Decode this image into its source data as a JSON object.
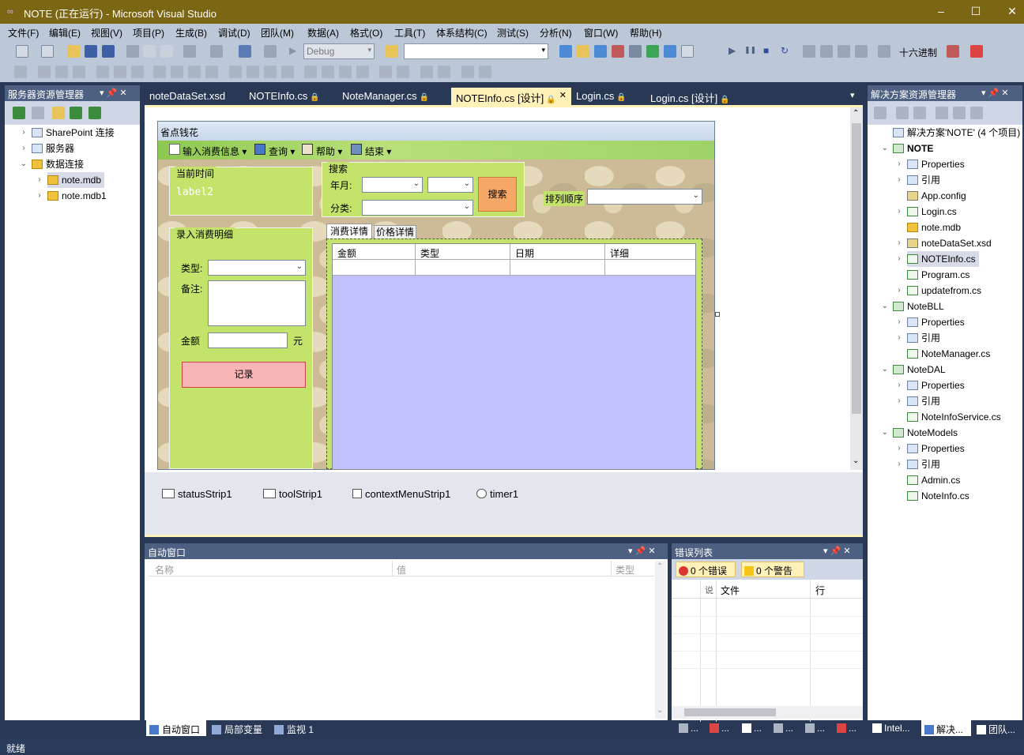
{
  "window": {
    "title": "NOTE (正在运行) - Microsoft Visual Studio",
    "logo": "∞",
    "minimize": "–",
    "maximize": "☐",
    "close": "✕"
  },
  "menu": [
    "文件(F)",
    "编辑(E)",
    "视图(V)",
    "项目(P)",
    "生成(B)",
    "调试(D)",
    "团队(M)",
    "数据(A)",
    "格式(O)",
    "工具(T)",
    "体系结构(C)",
    "测试(S)",
    "分析(N)",
    "窗口(W)",
    "帮助(H)"
  ],
  "toolbar": {
    "config": "Debug",
    "hex": "十六进制",
    "dropdown_arrow": "▾",
    "play": "▶",
    "pause": "❚❚",
    "stop": "■",
    "restart": "↻"
  },
  "server_explorer": {
    "title": "服务器资源管理器",
    "pin": "▾ 📌 ✕",
    "items": [
      {
        "label": "SharePoint 连接",
        "expander": "›"
      },
      {
        "label": "服务器",
        "expander": "›"
      },
      {
        "label": "数据连接",
        "expander": "⌄"
      },
      {
        "label": "note.mdb",
        "expander": "›"
      },
      {
        "label": "note.mdb1",
        "expander": "›"
      }
    ]
  },
  "doc_tabs": [
    {
      "label": "noteDataSet.xsd",
      "lock": ""
    },
    {
      "label": "NOTEInfo.cs",
      "lock": "🔒"
    },
    {
      "label": "NoteManager.cs",
      "lock": "🔒"
    },
    {
      "label": "NOTEInfo.cs [设计]",
      "lock": "🔒",
      "close": "✕"
    },
    {
      "label": "Login.cs",
      "lock": "🔒"
    },
    {
      "label": "Login.cs [设计]",
      "lock": "🔒"
    }
  ],
  "doc_tabs_overflow": "▾",
  "designer": {
    "form_title": "省点钱花",
    "menu_items": [
      "输入消费信息",
      "查询",
      "帮助",
      "结束"
    ],
    "menu_arrow": "▾",
    "group_time": {
      "title": "当前时间",
      "label": "label2"
    },
    "group_search": {
      "title": "搜索",
      "year_label": "年月:",
      "category_label": "分类:",
      "button": "搜索"
    },
    "sort_label": "排列顺序",
    "group_entry": {
      "title": "录入消费明细",
      "type_label": "类型:",
      "note_label": "备注:",
      "amount_label": "金额",
      "unit": "元",
      "button": "记录"
    },
    "tabs": [
      "消费详情",
      "价格详情"
    ],
    "grid_headers": [
      "金额",
      "类型",
      "日期",
      "详细"
    ],
    "scroll_up": "⌃",
    "scroll_down": "⌄",
    "components": [
      "statusStrip1",
      "toolStrip1",
      "contextMenuStrip1",
      "timer1"
    ]
  },
  "solution_explorer": {
    "title": "解决方案资源管理器",
    "pin": "▾ 📌 ✕",
    "items": [
      {
        "label": "解决方案'NOTE' (4 个项目)",
        "level": 0,
        "icon": "sol",
        "exp": ""
      },
      {
        "label": "NOTE",
        "level": 0,
        "icon": "proj",
        "exp": "⌄",
        "bold": true
      },
      {
        "label": "Properties",
        "level": 1,
        "icon": "fold",
        "exp": "›"
      },
      {
        "label": "引用",
        "level": 1,
        "icon": "fold",
        "exp": "›"
      },
      {
        "label": "App.config",
        "level": 1,
        "icon": "file",
        "exp": ""
      },
      {
        "label": "Login.cs",
        "level": 1,
        "icon": "cs",
        "exp": "›"
      },
      {
        "label": "note.mdb",
        "level": 1,
        "icon": "db",
        "exp": ""
      },
      {
        "label": "noteDataSet.xsd",
        "level": 1,
        "icon": "file",
        "exp": "›"
      },
      {
        "label": "NOTEInfo.cs",
        "level": 1,
        "icon": "cs",
        "exp": "›",
        "selected": true
      },
      {
        "label": "Program.cs",
        "level": 1,
        "icon": "cs",
        "exp": ""
      },
      {
        "label": "updatefrom.cs",
        "level": 1,
        "icon": "cs",
        "exp": "›"
      },
      {
        "label": "NoteBLL",
        "level": 0,
        "icon": "proj",
        "exp": "⌄"
      },
      {
        "label": "Properties",
        "level": 1,
        "icon": "fold",
        "exp": "›"
      },
      {
        "label": "引用",
        "level": 1,
        "icon": "fold",
        "exp": "›"
      },
      {
        "label": "NoteManager.cs",
        "level": 1,
        "icon": "cs",
        "exp": ""
      },
      {
        "label": "NoteDAL",
        "level": 0,
        "icon": "proj",
        "exp": "⌄"
      },
      {
        "label": "Properties",
        "level": 1,
        "icon": "fold",
        "exp": "›"
      },
      {
        "label": "引用",
        "level": 1,
        "icon": "fold",
        "exp": "›"
      },
      {
        "label": "NoteInfoService.cs",
        "level": 1,
        "icon": "cs",
        "exp": ""
      },
      {
        "label": "NoteModels",
        "level": 0,
        "icon": "proj",
        "exp": "⌄"
      },
      {
        "label": "Properties",
        "level": 1,
        "icon": "fold",
        "exp": "›"
      },
      {
        "label": "引用",
        "level": 1,
        "icon": "fold",
        "exp": "›"
      },
      {
        "label": "Admin.cs",
        "level": 1,
        "icon": "cs",
        "exp": ""
      },
      {
        "label": "NoteInfo.cs",
        "level": 1,
        "icon": "cs",
        "exp": ""
      }
    ]
  },
  "autos": {
    "title": "自动窗口",
    "pin": "▾ 📌 ✕",
    "columns": [
      "名称",
      "值",
      "类型"
    ]
  },
  "error_list": {
    "title": "错误列表",
    "pin": "▾ 📌 ✕",
    "errors": "0 个错误",
    "warnings": "0 个警告",
    "columns": [
      "文件",
      "行"
    ],
    "col_icon": "说"
  },
  "bottom_tabs_left": [
    "自动窗口",
    "局部变量",
    "监视 1"
  ],
  "bottom_tabs_mid": [
    "...",
    "...",
    "...",
    "...",
    "...",
    "..."
  ],
  "bottom_tabs_right": [
    "Intel...",
    "解决...",
    "团队..."
  ],
  "status": "就绪"
}
